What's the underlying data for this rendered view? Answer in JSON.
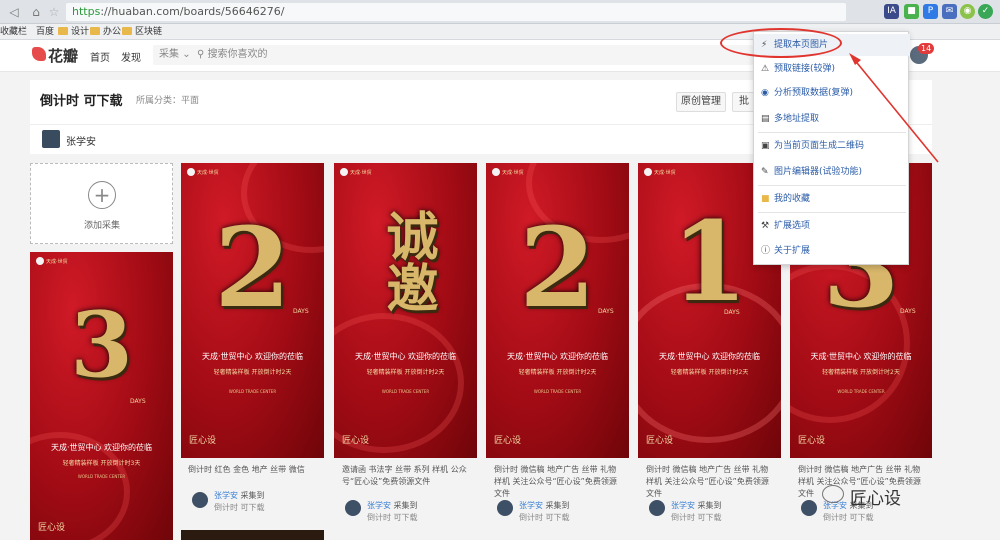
{
  "browser": {
    "url_scheme": "https",
    "url_rest": "://huaban.com/boards/56646276/",
    "bookmarks": [
      {
        "label": "收藏栏"
      },
      {
        "label": "百度"
      },
      {
        "label": "设计"
      },
      {
        "label": "办公"
      },
      {
        "label": "区块链"
      }
    ]
  },
  "site": {
    "logo": "花瓣",
    "nav": [
      "首页",
      "发现"
    ],
    "search_scope": "采集",
    "search_placeholder": "搜索你喜欢的",
    "notif_count": "14"
  },
  "board": {
    "title": "倒计时 可下载",
    "category": "所属分类：平面",
    "actions": [
      "原创管理",
      "批"
    ],
    "owner": "张学安"
  },
  "add_card": {
    "label": "添加采集"
  },
  "posters": {
    "headline": "天成·世贸中心  欢迎你的莅临",
    "headline2": "天成·世贸中心 欢迎你的莅临",
    "subline": "轻奢精装样板  开放倒计时2天",
    "subline3": "轻奢精装样板  开放倒计时3天",
    "en1": "WORLD TRADE CENTER",
    "foot_brand": "匠心设",
    "days": "DAYS",
    "nums": [
      "3",
      "2",
      "诚邀",
      "2",
      "1",
      "3"
    ]
  },
  "pins": [
    {
      "desc": "倒计时 红色 金色 地产 丝带 微信",
      "user": "张学安",
      "action": "采集到",
      "board": "倒计时 可下载"
    },
    {
      "desc": "邀请函 书法字 丝带 系列 样机 公众号“匠心设”免费领源文件",
      "user": "张学安",
      "action": "采集到",
      "board": "倒计时 可下载"
    },
    {
      "desc": "倒计时 微信稿 地产广告 丝带 礼物 样机 关注公众号“匠心设”免费领源文件",
      "user": "张学安",
      "action": "采集到",
      "board": "倒计时 可下载"
    },
    {
      "desc": "倒计时 微信稿 地产广告 丝带 礼物 样机 关注公众号“匠心设”免费领源文件",
      "user": "张学安",
      "action": "采集到",
      "board": "倒计时 可下载"
    },
    {
      "desc": "倒计时 微信稿 地产广告 丝带 礼物 样机 关注公众号“匠心设”免费领源文件",
      "user": "张学安",
      "action": "采集到",
      "board": "倒计时 可下载"
    }
  ],
  "menu": {
    "items": [
      {
        "icon": "lightning-icon",
        "label": "提取本页图片"
      },
      {
        "icon": "warning-icon",
        "label": "预取链接(较弹)"
      },
      {
        "icon": "chart-icon",
        "label": "分析预取数据(复弹)"
      },
      {
        "icon": "list-icon",
        "label": "多地址提取"
      },
      {
        "icon": "qrcode-icon",
        "label": "为当前页面生成二维码"
      },
      {
        "icon": "edit-icon",
        "label": "图片编辑器(试验功能)"
      },
      {
        "icon": "folder-icon",
        "label": "我的收藏"
      },
      {
        "icon": "wrench-icon",
        "label": "扩展选项"
      },
      {
        "icon": "info-icon",
        "label": "关于扩展"
      }
    ]
  },
  "watermark": "匠心设",
  "colors": {
    "accent": "#e0352e",
    "link": "#2b5ca8",
    "poster_red": "#a10b14",
    "gold": "#d8b66a"
  }
}
